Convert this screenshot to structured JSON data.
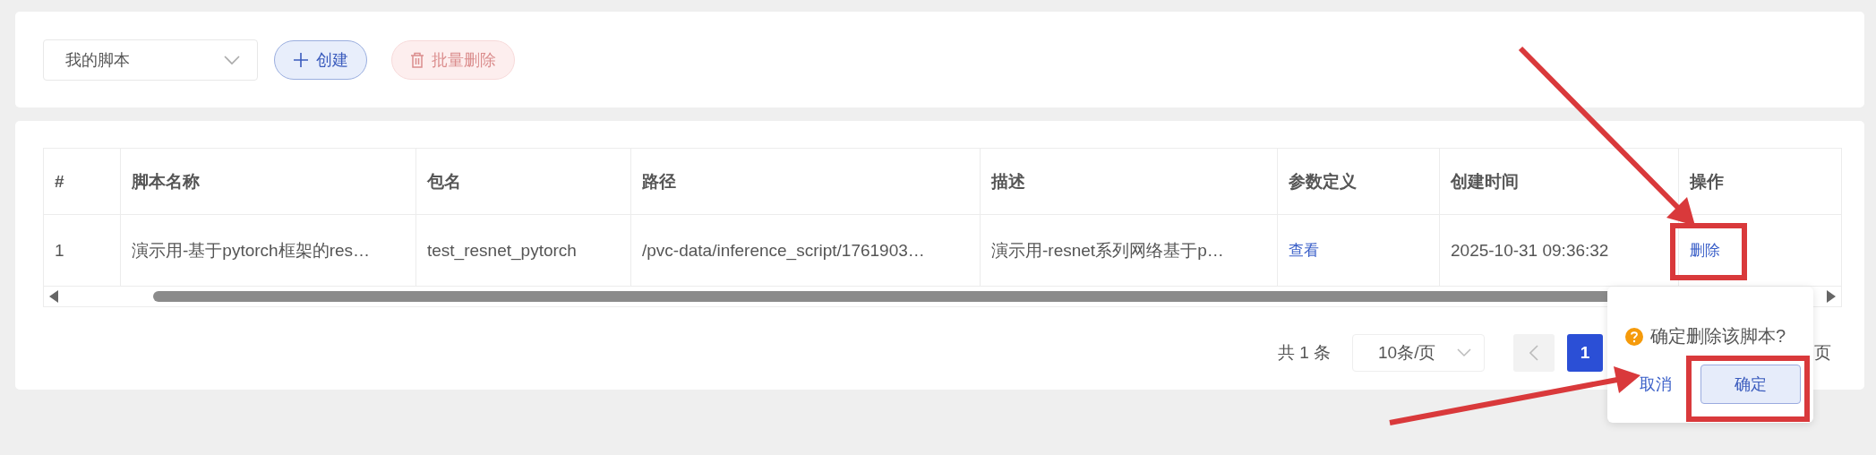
{
  "toolbar": {
    "script_filter": {
      "value": "我的脚本"
    },
    "buttons": [
      {
        "kind": "create",
        "label": "创建",
        "disabled": false
      },
      {
        "kind": "batch_delete",
        "label": "批量删除",
        "disabled": true
      }
    ]
  },
  "table": {
    "columns": [
      "#",
      "脚本名称",
      "包名",
      "路径",
      "描述",
      "参数定义",
      "创建时间",
      "操作"
    ],
    "rows": [
      {
        "cells": [
          "1",
          "演示用-基于pytorch框架的res…",
          "test_resnet_pytorch",
          "/pvc-data/inference_script/1761903…",
          "演示用-resnet系列网络基于p…",
          "查看",
          "2025-10-31 09:36:32",
          "删除"
        ]
      }
    ]
  },
  "pagination": {
    "total": "共 1 条",
    "page_size": "10条/页",
    "prev_disabled": true,
    "pages": [
      {
        "label": "1",
        "selected": true
      }
    ],
    "trailing": "页"
  },
  "popconfirm": {
    "message": "确定删除该脚本?",
    "cancel": "取消",
    "confirm": "确定"
  }
}
